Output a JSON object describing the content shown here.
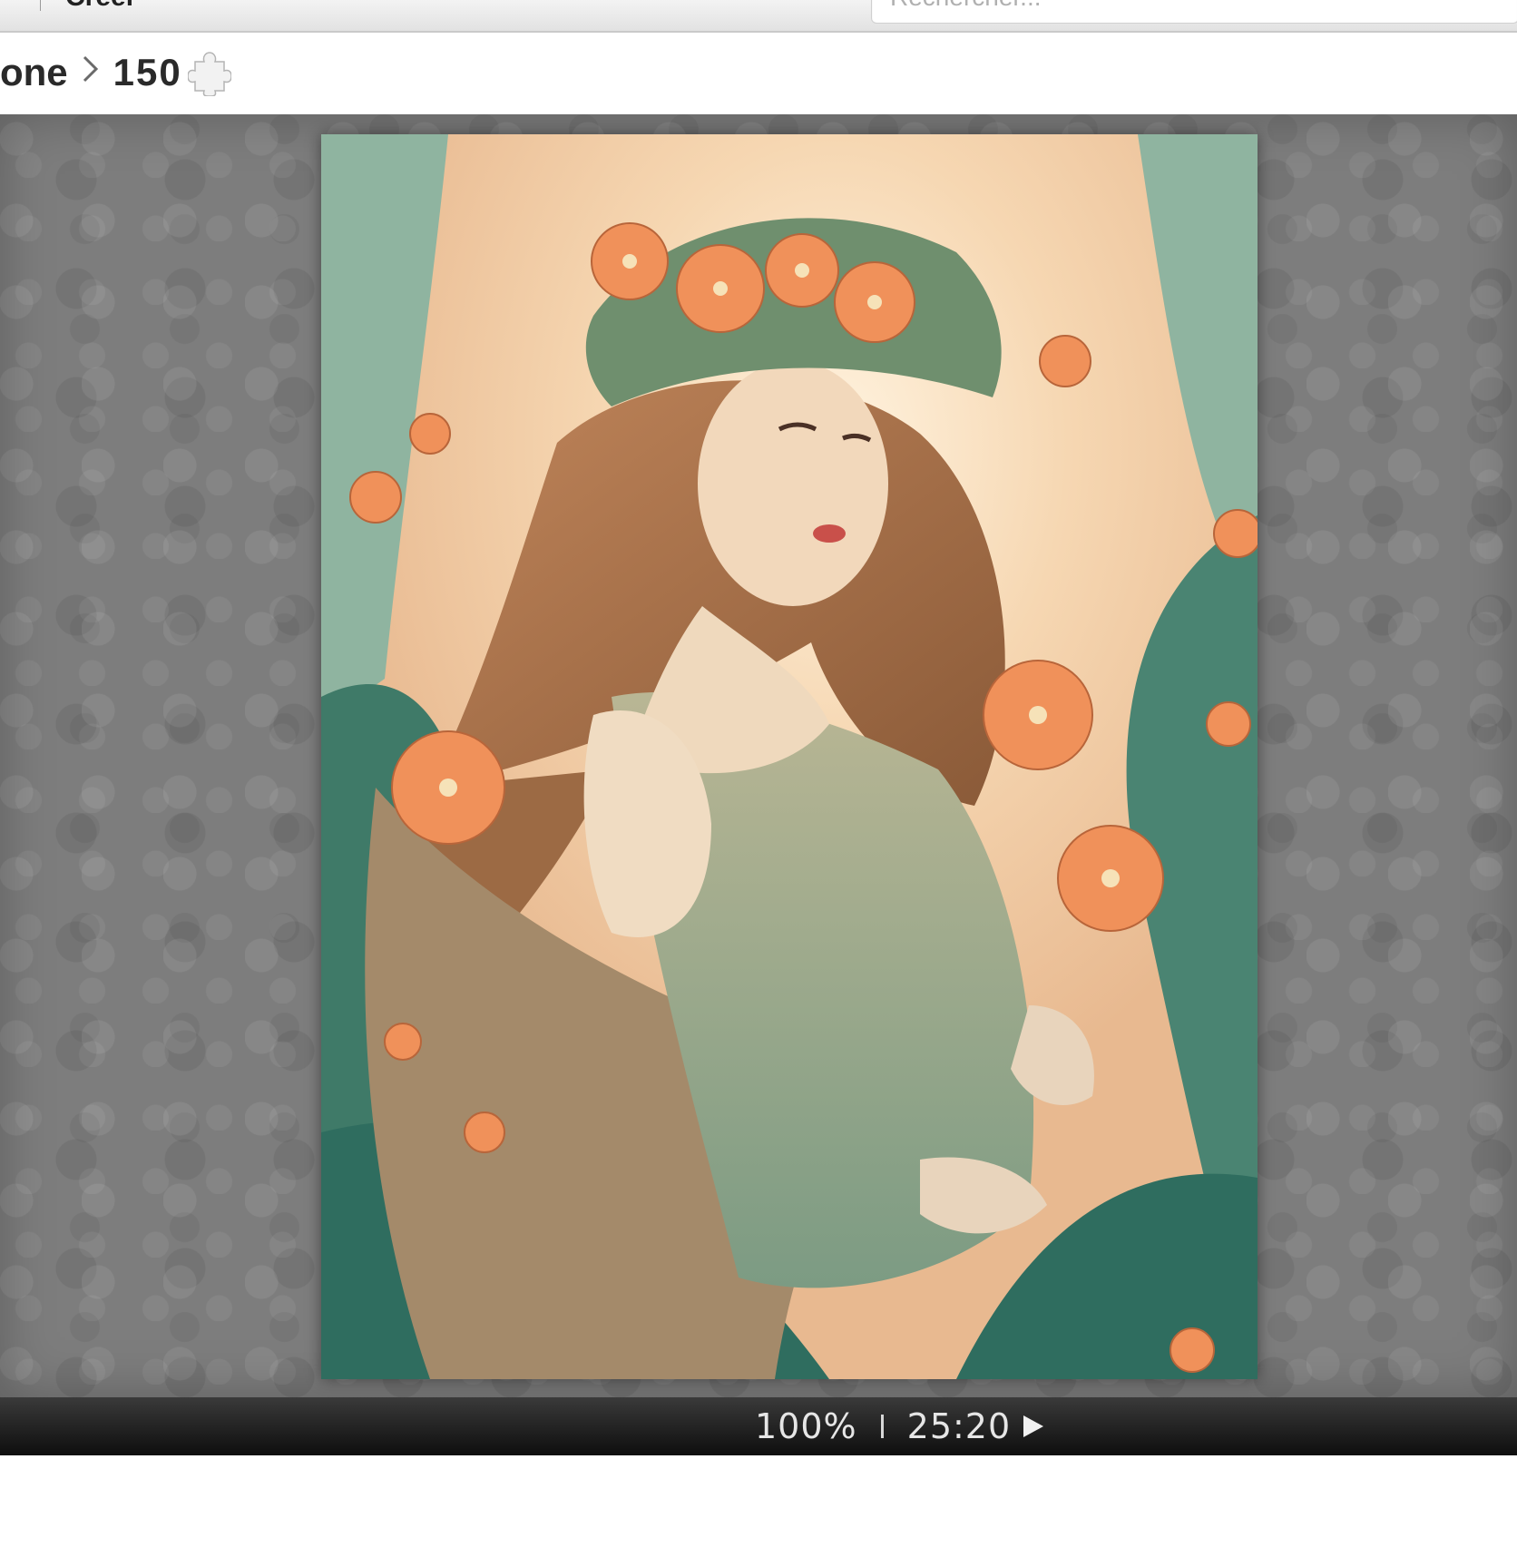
{
  "header": {
    "create_label": "Créer",
    "search_placeholder": "Rechercher..."
  },
  "breadcrumb": {
    "parent": "one",
    "piece_count": "150"
  },
  "status_bar": {
    "zoom": "100%",
    "timer": "25:20"
  },
  "icons": {
    "breadcrumb_separator": "chevron-right-icon",
    "piece_count_icon": "puzzle-piece-icon",
    "play": "play-icon"
  },
  "colors": {
    "stage_background": "#7d7d7d",
    "status_bar": "#1a1a1a",
    "status_text": "#e6e6e6"
  }
}
